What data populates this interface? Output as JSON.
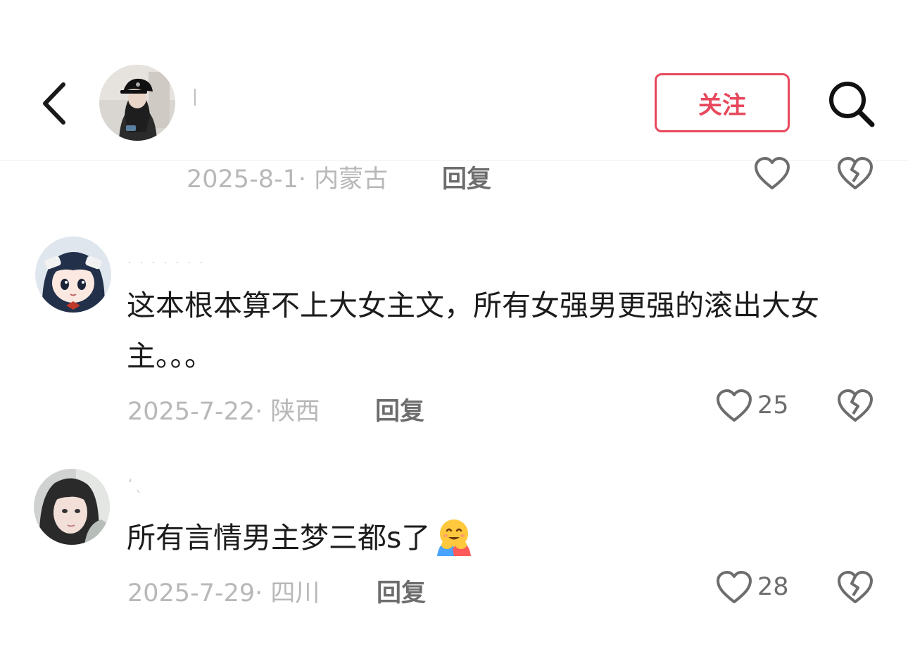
{
  "header": {
    "username": "▏",
    "follow_label": "关注",
    "icons": {
      "back": "chevron-left-icon",
      "search": "search-icon"
    }
  },
  "comments": [
    {
      "date_location": "2025-8-1· 内蒙古",
      "reply_label": "回复",
      "like_count": ""
    },
    {
      "username": ". . . . . . .",
      "text": "这本根本算不上大女主文，所有女强男更强的滚出大女主。。。",
      "date_location": "2025-7-22· 陕西",
      "reply_label": "回复",
      "like_count": "25"
    },
    {
      "username": "ʻˎ",
      "text": "所有言情男主梦三都s了",
      "emoji": "hugging-face-emoji",
      "date_location": "2025-7-29· 四川",
      "reply_label": "回复",
      "like_count": "28"
    }
  ],
  "colors": {
    "accent": "#e8485c",
    "meta_gray": "#b8b8b8",
    "icon_gray": "#6d6d6d",
    "text": "#1c1c1c"
  }
}
